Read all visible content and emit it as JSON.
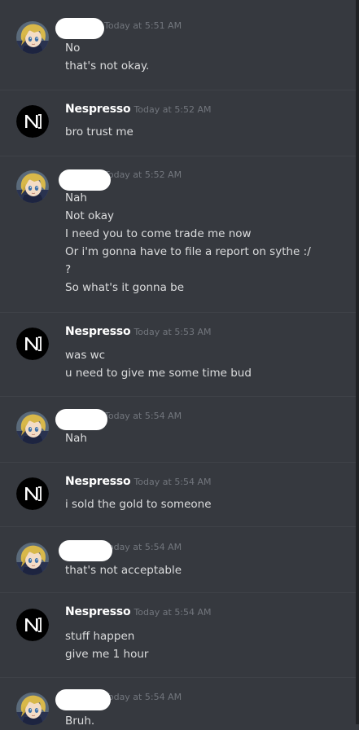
{
  "messages": [
    {
      "author": "",
      "redacted": true,
      "avatar": "anime-girl-avatar",
      "timestamp": "Today at 5:51 AM",
      "lines": [
        "No",
        "that's not okay."
      ]
    },
    {
      "author": "Nespresso",
      "redacted": false,
      "avatar": "nespresso-logo-avatar",
      "timestamp": "Today at 5:52 AM",
      "lines": [
        "bro trust me"
      ]
    },
    {
      "author": "",
      "redacted": true,
      "avatar": "anime-girl-avatar",
      "timestamp": "Today at 5:52 AM",
      "lines": [
        "Nah",
        "Not okay",
        "I need you to come trade me now",
        "Or i'm gonna have to file a report on sythe :/",
        "?",
        "So what's it gonna be"
      ]
    },
    {
      "author": "Nespresso",
      "redacted": false,
      "avatar": "nespresso-logo-avatar",
      "timestamp": "Today at 5:53 AM",
      "lines": [
        "was wc",
        "u need to give me some time bud"
      ]
    },
    {
      "author": "",
      "redacted": true,
      "avatar": "anime-girl-avatar",
      "timestamp": "Today at 5:54 AM",
      "lines": [
        "Nah"
      ]
    },
    {
      "author": "Nespresso",
      "redacted": false,
      "avatar": "nespresso-logo-avatar",
      "timestamp": "Today at 5:54 AM",
      "lines": [
        "i sold the gold to someone"
      ]
    },
    {
      "author": "",
      "redacted": true,
      "avatar": "anime-girl-avatar",
      "timestamp": "Today at 5:54 AM",
      "lines": [
        "that's not acceptable"
      ]
    },
    {
      "author": "Nespresso",
      "redacted": false,
      "avatar": "nespresso-logo-avatar",
      "timestamp": "Today at 5:54 AM",
      "lines": [
        "stuff happen",
        "give me 1 hour"
      ]
    },
    {
      "author": "",
      "redacted": true,
      "avatar": "anime-girl-avatar",
      "timestamp": "Today at 5:54 AM",
      "lines": [
        "Bruh."
      ]
    }
  ],
  "colors": {
    "background": "#36393f",
    "username": "#ffffff",
    "timestamp": "#72767d",
    "message_text": "#dcddde",
    "redaction": "#ffffff",
    "nespresso_avatar_bg": "#000000"
  }
}
